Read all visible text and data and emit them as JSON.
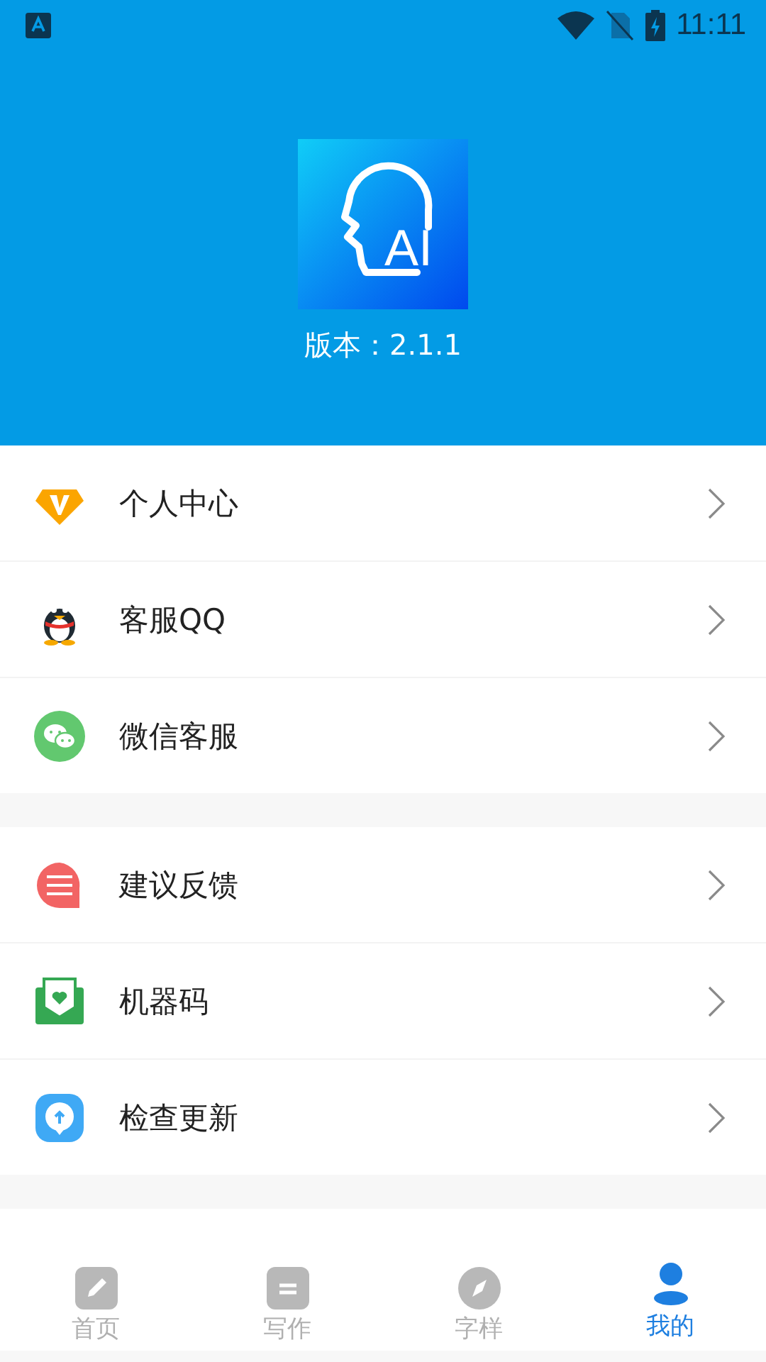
{
  "status_bar": {
    "time": "11:11"
  },
  "header": {
    "logo_text": "AI",
    "version": "版本：2.1.1"
  },
  "groups": [
    {
      "items": [
        {
          "kind": "vip",
          "label": "个人中心"
        },
        {
          "kind": "qq",
          "label": "客服QQ"
        },
        {
          "kind": "wechat",
          "label": "微信客服"
        }
      ]
    },
    {
      "items": [
        {
          "kind": "feedback",
          "label": "建议反馈"
        },
        {
          "kind": "machine",
          "label": "机器码"
        },
        {
          "kind": "update",
          "label": "检查更新"
        }
      ]
    }
  ],
  "bottom_nav": [
    {
      "kind": "pencil",
      "label": "首页",
      "selected": false
    },
    {
      "kind": "doc",
      "label": "写作",
      "selected": false
    },
    {
      "kind": "compass",
      "label": "字样",
      "selected": false
    },
    {
      "kind": "person",
      "label": "我的",
      "selected": true
    }
  ]
}
